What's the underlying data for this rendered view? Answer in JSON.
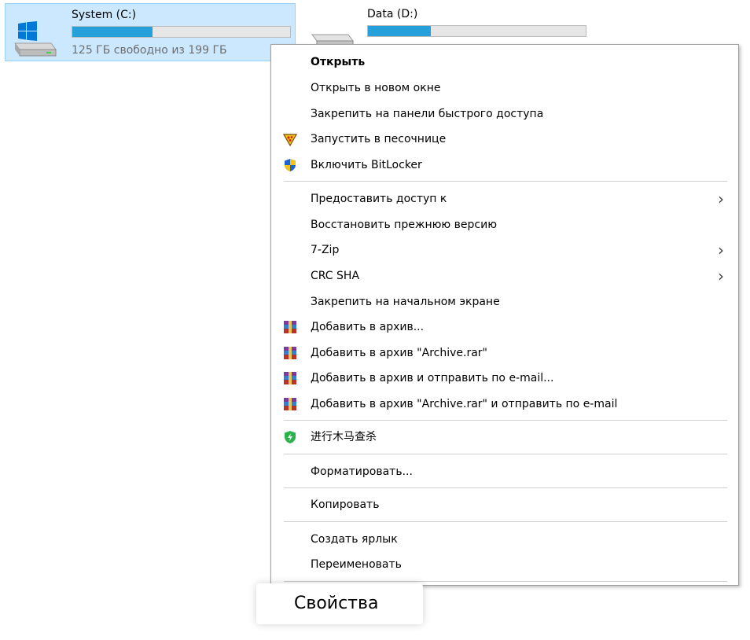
{
  "drives": {
    "c": {
      "name": "System (C:)",
      "free_text": "125 ГБ свободно из 199 ГБ",
      "used_fraction": 0.37
    },
    "d": {
      "name": "Data (D:)",
      "used_fraction": 0.29
    }
  },
  "menu": {
    "items": [
      {
        "label": "Открыть"
      },
      {
        "label": "Открыть в новом окне"
      },
      {
        "label": "Закрепить на панели быстрого доступа"
      },
      {
        "label": "Запустить в песочнице",
        "icon": "sandbox-icon"
      },
      {
        "label": "Включить BitLocker",
        "icon": "uac-shield-icon"
      },
      {
        "label": "Предоставить доступ к"
      },
      {
        "label": "Восстановить прежнюю версию"
      },
      {
        "label": "7-Zip"
      },
      {
        "label": "CRC SHA"
      },
      {
        "label": "Закрепить на начальном экране"
      },
      {
        "label": "Добавить в архив...",
        "icon": "winrar-icon"
      },
      {
        "label": "Добавить в архив \"Archive.rar\"",
        "icon": "winrar-icon"
      },
      {
        "label": "Добавить в архив и отправить по e-mail...",
        "icon": "winrar-icon"
      },
      {
        "label": "Добавить в архив \"Archive.rar\" и отправить по e-mail",
        "icon": "winrar-icon"
      },
      {
        "label": "进行木马查杀",
        "icon": "security-shield-icon"
      },
      {
        "label": "Форматировать..."
      },
      {
        "label": "Копировать"
      },
      {
        "label": "Создать ярлык"
      },
      {
        "label": "Переименовать"
      }
    ],
    "properties_label": "Свойства"
  },
  "colors": {
    "selection": "#cce8ff",
    "bar_fill": "#26a0da",
    "shield_green": "#2bb24c"
  }
}
